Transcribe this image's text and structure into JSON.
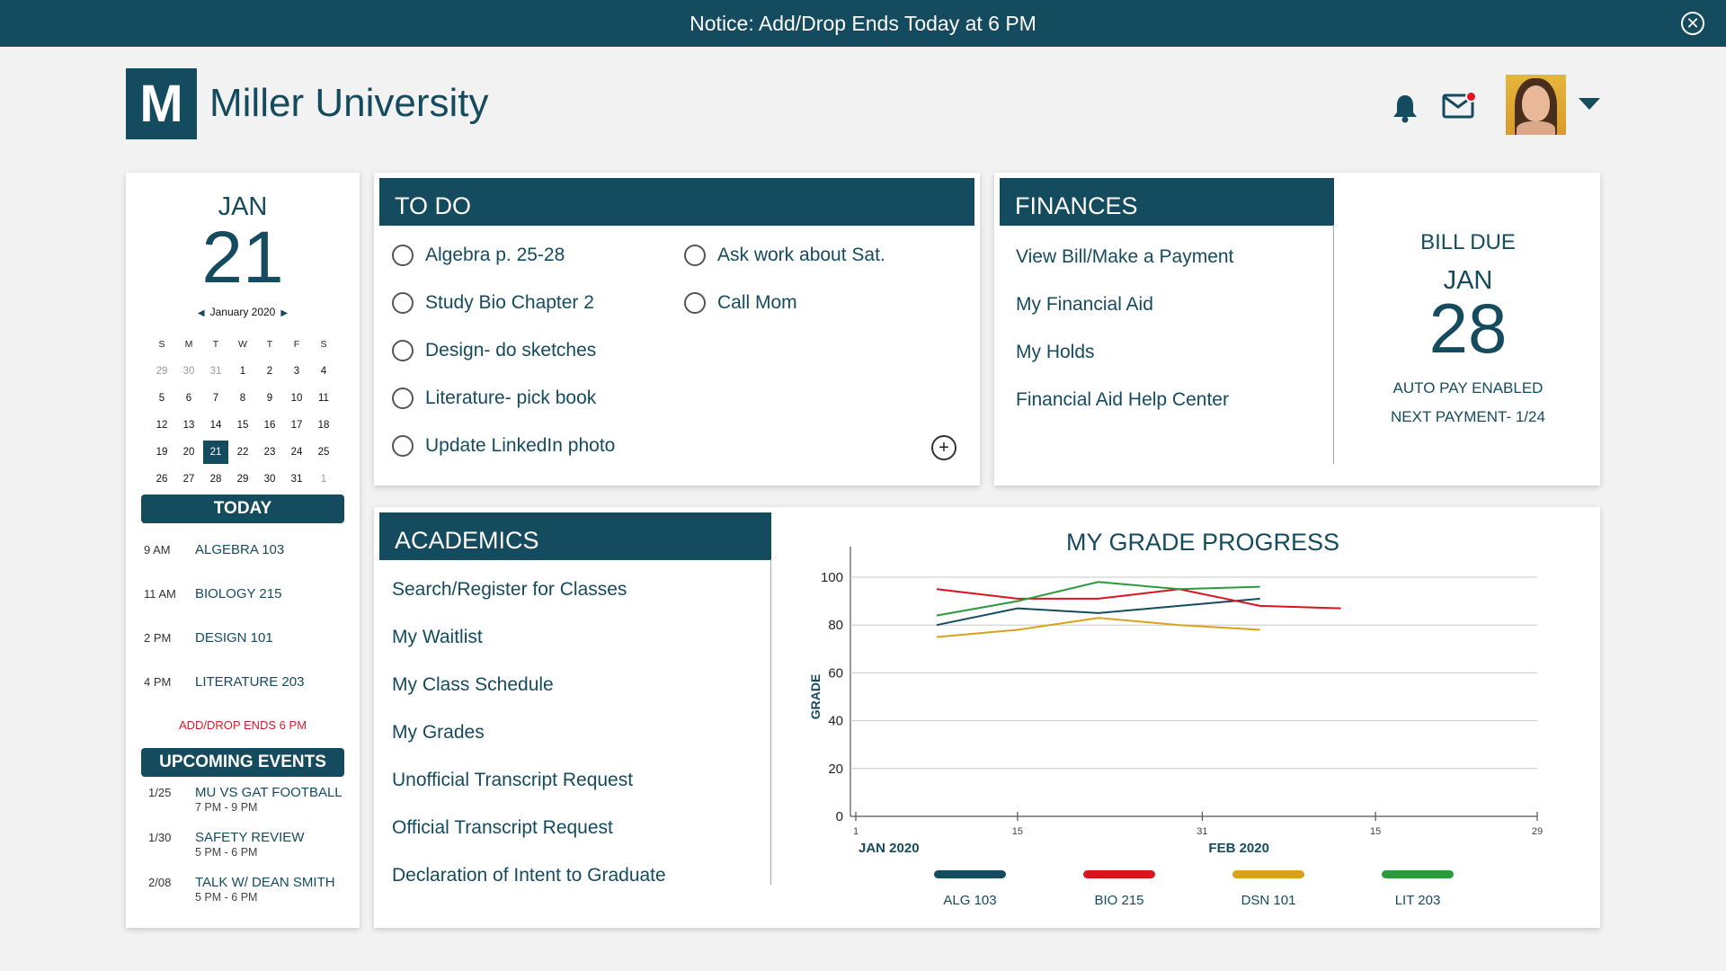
{
  "notice": {
    "text": "Notice: Add/Drop Ends Today at 6 PM"
  },
  "brand": {
    "logo_letter": "M",
    "name": "Miller University"
  },
  "header": {
    "notifications_icon": "bell-icon",
    "mail_icon": "envelope-icon",
    "menu_icon": "caret-down-icon"
  },
  "calendar": {
    "month": "JAN",
    "day": "21",
    "mini_title": "January 2020",
    "weekdays": [
      "S",
      "M",
      "T",
      "W",
      "T",
      "F",
      "S"
    ],
    "weeks": [
      [
        "29",
        "30",
        "31",
        "1",
        "2",
        "3",
        "4"
      ],
      [
        "5",
        "6",
        "7",
        "8",
        "9",
        "10",
        "11"
      ],
      [
        "12",
        "13",
        "14",
        "15",
        "16",
        "17",
        "18"
      ],
      [
        "19",
        "20",
        "21",
        "22",
        "23",
        "24",
        "25"
      ],
      [
        "26",
        "27",
        "28",
        "29",
        "30",
        "31",
        "1"
      ]
    ],
    "selected": "21"
  },
  "today": {
    "label": "TODAY",
    "items": [
      {
        "time": "9 AM",
        "name": "ALGEBRA 103"
      },
      {
        "time": "11 AM",
        "name": "BIOLOGY 215"
      },
      {
        "time": "2 PM",
        "name": "DESIGN 101"
      },
      {
        "time": "4 PM",
        "name": "LITERATURE 203"
      }
    ],
    "alert": "ADD/DROP ENDS 6 PM"
  },
  "events": {
    "label": "UPCOMING EVENTS",
    "items": [
      {
        "date": "1/25",
        "name": "MU VS GAT FOOTBALL",
        "time": "7 PM - 9 PM"
      },
      {
        "date": "1/30",
        "name": "SAFETY REVIEW",
        "time": "5 PM - 6 PM"
      },
      {
        "date": "2/08",
        "name": "TALK W/ DEAN SMITH",
        "time": "5 PM - 6 PM"
      }
    ]
  },
  "todo": {
    "title": "TO DO",
    "items": [
      "Algebra p. 25-28",
      "Study Bio Chapter 2",
      "Design- do sketches",
      "Literature- pick book",
      "Update LinkedIn photo",
      "Ask work about Sat.",
      "Call Mom"
    ]
  },
  "finances": {
    "title": "FINANCES",
    "links": [
      "View Bill/Make a Payment",
      "My Financial Aid",
      "My Holds",
      "Financial Aid Help Center"
    ],
    "bill_due_label": "BILL DUE",
    "bill_month": "JAN",
    "bill_day": "28",
    "autopay": "AUTO PAY ENABLED",
    "next_payment": "NEXT PAYMENT- 1/24"
  },
  "academics": {
    "title": "ACADEMICS",
    "links": [
      "Search/Register for Classes",
      "My Waitlist",
      "My Class Schedule",
      "My Grades",
      "Unofficial Transcript Request",
      "Official Transcript Request",
      "Declaration of Intent to Graduate"
    ]
  },
  "chart_data": {
    "type": "line",
    "title": "MY GRADE PROGRESS",
    "ylabel": "GRADE",
    "xlabel": "",
    "ylim": [
      0,
      100
    ],
    "yticks": [
      "0",
      "20",
      "40",
      "60",
      "80",
      "100"
    ],
    "xticks": [
      "1",
      "15",
      "31",
      "15",
      "29"
    ],
    "xgroup_labels": [
      "JAN 2020",
      "FEB 2020"
    ],
    "x": [
      8,
      15,
      22,
      29,
      36,
      43
    ],
    "series": [
      {
        "name": "ALG 103",
        "color": "#154b5e",
        "values": [
          80,
          87,
          85,
          88,
          91,
          null
        ]
      },
      {
        "name": "BIO 215",
        "color": "#d9141e",
        "values": [
          95,
          91,
          91,
          95,
          88,
          87
        ]
      },
      {
        "name": "DSN 101",
        "color": "#d9a21a",
        "values": [
          75,
          78,
          83,
          80,
          78,
          null
        ]
      },
      {
        "name": "LIT 203",
        "color": "#2a9a3c",
        "values": [
          84,
          90,
          98,
          95,
          96,
          null
        ]
      }
    ],
    "grid": true,
    "legend": "bottom"
  }
}
